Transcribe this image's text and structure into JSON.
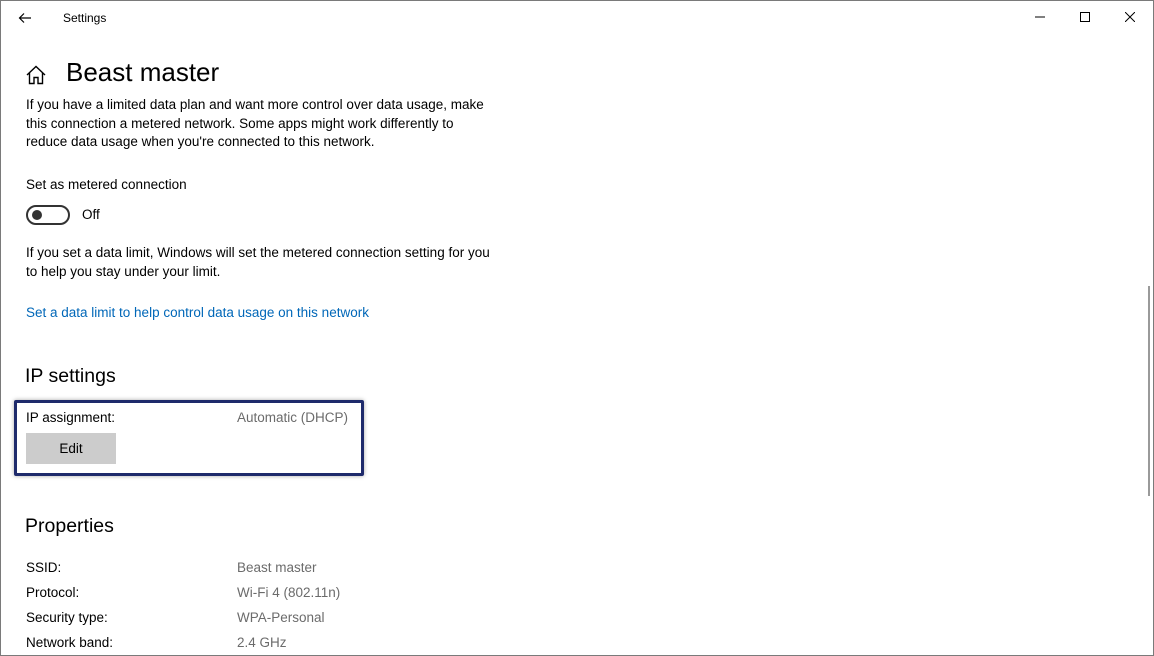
{
  "window": {
    "title": "Settings"
  },
  "page": {
    "title": "Beast master"
  },
  "metered": {
    "description": "If you have a limited data plan and want more control over data usage, make this connection a metered network. Some apps might work differently to reduce data usage when you're connected to this network.",
    "toggle_label": "Set as metered connection",
    "toggle_state": "Off",
    "data_limit_description": "If you set a data limit, Windows will set the metered connection setting for you to help you stay under your limit.",
    "data_limit_link": "Set a data limit to help control data usage on this network"
  },
  "ip_settings": {
    "title": "IP settings",
    "assignment_label": "IP assignment:",
    "assignment_value": "Automatic (DHCP)",
    "edit_label": "Edit"
  },
  "properties": {
    "title": "Properties",
    "rows": [
      {
        "label": "SSID:",
        "value": "Beast master"
      },
      {
        "label": "Protocol:",
        "value": "Wi-Fi 4 (802.11n)"
      },
      {
        "label": "Security type:",
        "value": "WPA-Personal"
      },
      {
        "label": "Network band:",
        "value": "2.4 GHz"
      }
    ]
  },
  "colors": {
    "link": "#0067b8",
    "highlight_border": "#1e2a6b",
    "button_bg": "#cccccc",
    "value_text": "#6b6b6b"
  },
  "icons": [
    "back-arrow-icon",
    "minimize-icon",
    "maximize-icon",
    "close-icon",
    "home-icon"
  ]
}
